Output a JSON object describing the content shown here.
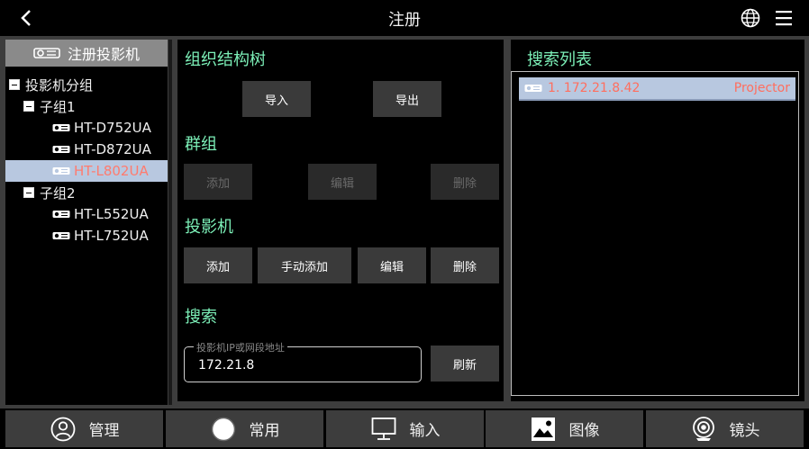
{
  "header": {
    "title": "注册"
  },
  "sidebar": {
    "tab_label": "注册投影机",
    "tree": [
      {
        "label": "投影机分组",
        "level": 0,
        "type": "group"
      },
      {
        "label": "子组1",
        "level": 1,
        "type": "group"
      },
      {
        "label": "HT-D752UA",
        "level": 2,
        "type": "projector"
      },
      {
        "label": "HT-D872UA",
        "level": 2,
        "type": "projector"
      },
      {
        "label": "HT-L802UA",
        "level": 2,
        "type": "projector",
        "selected": true
      },
      {
        "label": "子组2",
        "level": 1,
        "type": "group"
      },
      {
        "label": "HT-L552UA",
        "level": 2,
        "type": "projector"
      },
      {
        "label": "HT-L752UA",
        "level": 2,
        "type": "projector"
      }
    ]
  },
  "org_tree": {
    "title": "组织结构树",
    "import_label": "导入",
    "export_label": "导出"
  },
  "group": {
    "title": "群组",
    "add_label": "添加",
    "edit_label": "编辑",
    "delete_label": "删除"
  },
  "projector": {
    "title": "投影机",
    "add_label": "添加",
    "manual_add_label": "手动添加",
    "edit_label": "编辑",
    "delete_label": "删除"
  },
  "search": {
    "title": "搜索",
    "legend": "投影机IP或网段地址",
    "value": "172.21.8",
    "refresh_label": "刷新"
  },
  "search_list": {
    "title": "搜索列表",
    "items": [
      {
        "ip": "1. 172.21.8.42",
        "type": "Projector"
      }
    ]
  },
  "bottom_nav": [
    {
      "label": "管理",
      "icon": "user-circle-icon"
    },
    {
      "label": "常用",
      "icon": "circle-icon"
    },
    {
      "label": "输入",
      "icon": "monitor-icon"
    },
    {
      "label": "图像",
      "icon": "image-icon"
    },
    {
      "label": "镜头",
      "icon": "lens-camera-icon"
    }
  ],
  "colors": {
    "accent_green": "#7cf0b8",
    "selected_bg": "#b8c8e0",
    "selected_text": "#ff7b6e",
    "panel_gray": "#3d3d3d"
  }
}
